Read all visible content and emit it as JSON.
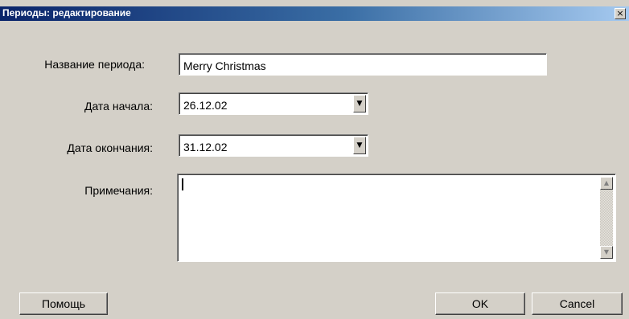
{
  "window": {
    "title": "Периоды: редактирование",
    "close_glyph": "×"
  },
  "form": {
    "period_name_label": "Название периода:",
    "period_name_value": "Merry Christmas",
    "start_date_label": "Дата начала:",
    "start_date_value": "26.12.02",
    "end_date_label": "Дата окончания:",
    "end_date_value": "31.12.02",
    "notes_label": "Примечания:",
    "notes_value": ""
  },
  "icons": {
    "dropdown": "▼",
    "scroll_up": "▲",
    "scroll_down": "▼"
  },
  "buttons": {
    "help": "Помощь",
    "ok": "OK",
    "cancel": "Cancel"
  }
}
